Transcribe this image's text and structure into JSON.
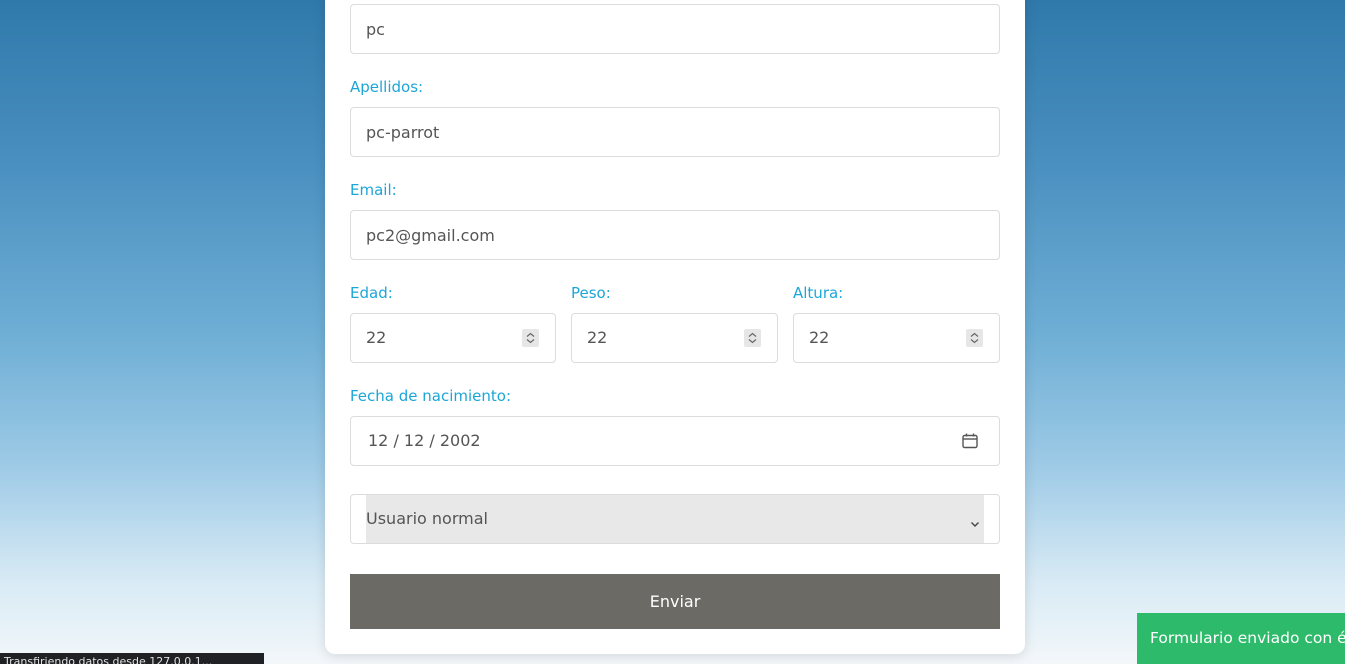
{
  "form": {
    "nombre_value": "pc",
    "apellidos_label": "Apellidos:",
    "apellidos_value": "pc-parrot",
    "email_label": "Email:",
    "email_value": "pc2@gmail.com",
    "edad_label": "Edad:",
    "edad_value": "22",
    "peso_label": "Peso:",
    "peso_value": "22",
    "altura_label": "Altura:",
    "altura_value": "22",
    "fecha_label": "Fecha de nacimiento:",
    "fecha_value": "12 / 12 / 2002",
    "tipo_usuario_value": "Usuario normal",
    "submit_label": "Enviar"
  },
  "toast": {
    "message": "Formulario enviado con é"
  },
  "status_bar": {
    "text": "Transfiriendo datos desde 127.0.0.1..."
  },
  "colors": {
    "label": "#1ca6d8",
    "submit_bg": "#6c6a64",
    "toast_bg": "#2dba6a"
  },
  "icons": {
    "spinner": "spinner-icon",
    "calendar": "calendar-icon",
    "select_arrow": "chevron-down-icon"
  }
}
